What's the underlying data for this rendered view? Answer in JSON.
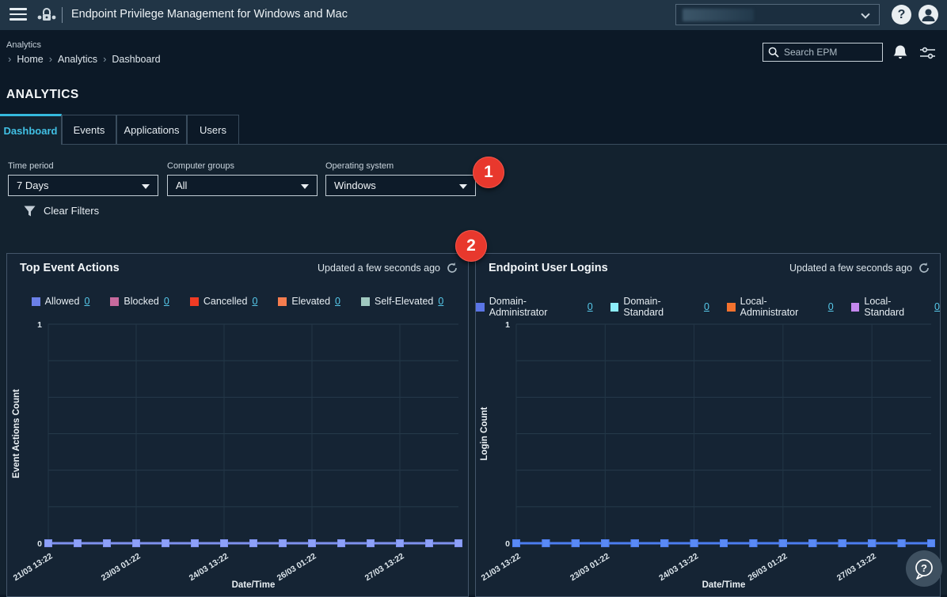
{
  "topbar": {
    "title": "Endpoint Privilege Management for Windows and Mac"
  },
  "header": {
    "section_label": "Analytics",
    "breadcrumb": [
      "Home",
      "Analytics",
      "Dashboard"
    ],
    "search_placeholder": "Search EPM"
  },
  "page_title": "ANALYTICS",
  "tabs": [
    {
      "label": "Dashboard",
      "active": true
    },
    {
      "label": "Events",
      "active": false
    },
    {
      "label": "Applications",
      "active": false
    },
    {
      "label": "Users",
      "active": false
    }
  ],
  "filters": {
    "fields": [
      {
        "label": "Time period",
        "value": "7 Days"
      },
      {
        "label": "Computer groups",
        "value": "All"
      },
      {
        "label": "Operating system",
        "value": "Windows"
      }
    ],
    "clear_label": "Clear Filters"
  },
  "callouts": [
    {
      "label": "1"
    },
    {
      "label": "2"
    }
  ],
  "colors": {
    "accent_cyan": "#41c0e4",
    "badge_red": "#e8382d",
    "link_cyan": "#56c9ea",
    "card_border": "#44566a"
  },
  "cards": [
    {
      "title": "Top Event Actions",
      "updated": "Updated a few seconds ago",
      "legend": [
        {
          "label": "Allowed",
          "value": "0",
          "color": "#6b80e8"
        },
        {
          "label": "Blocked",
          "value": "0",
          "color": "#c76a9d"
        },
        {
          "label": "Cancelled",
          "value": "0",
          "color": "#ef3b24"
        },
        {
          "label": "Elevated",
          "value": "0",
          "color": "#f57d4f"
        },
        {
          "label": "Self-Elevated",
          "value": "0",
          "color": "#a0c9c0"
        }
      ]
    },
    {
      "title": "Endpoint User Logins",
      "updated": "Updated a few seconds ago",
      "legend": [
        {
          "label": "Domain-Administrator",
          "value": "0",
          "color": "#5a75e6"
        },
        {
          "label": "Domain-Standard",
          "value": "0",
          "color": "#8deefc"
        },
        {
          "label": "Local-Administrator",
          "value": "0",
          "color": "#f4722e"
        },
        {
          "label": "Local-Standard",
          "value": "0",
          "color": "#c488ee"
        }
      ]
    }
  ],
  "chart_data": [
    {
      "type": "line",
      "title": "Top Event Actions",
      "xlabel": "Date/Time",
      "ylabel": "Event Actions Count",
      "ylim": [
        0,
        1
      ],
      "y_ticks": [
        0,
        1
      ],
      "grid": true,
      "legend_position": "top",
      "num_points": 15,
      "x_tick_labels": [
        "21/03 13:22",
        "23/03 01:22",
        "24/03 13:22",
        "26/03 01:22",
        "27/03 13:22"
      ],
      "x_tick_indices": [
        0,
        3,
        6,
        9,
        12
      ],
      "series": [
        {
          "name": "Allowed",
          "color": "#7e91ee",
          "marker": "#8da0f8",
          "values": [
            0,
            0,
            0,
            0,
            0,
            0,
            0,
            0,
            0,
            0,
            0,
            0,
            0,
            0,
            0
          ]
        },
        {
          "name": "Blocked",
          "color": "#c76a9d",
          "marker": "#c76a9d",
          "values": [
            0,
            0,
            0,
            0,
            0,
            0,
            0,
            0,
            0,
            0,
            0,
            0,
            0,
            0,
            0
          ]
        },
        {
          "name": "Cancelled",
          "color": "#ef3b24",
          "marker": "#ef3b24",
          "values": [
            0,
            0,
            0,
            0,
            0,
            0,
            0,
            0,
            0,
            0,
            0,
            0,
            0,
            0,
            0
          ]
        },
        {
          "name": "Elevated",
          "color": "#f57d4f",
          "marker": "#f57d4f",
          "values": [
            0,
            0,
            0,
            0,
            0,
            0,
            0,
            0,
            0,
            0,
            0,
            0,
            0,
            0,
            0
          ]
        },
        {
          "name": "Self-Elevated",
          "color": "#a0c9c0",
          "marker": "#a0c9c0",
          "values": [
            0,
            0,
            0,
            0,
            0,
            0,
            0,
            0,
            0,
            0,
            0,
            0,
            0,
            0,
            0
          ]
        }
      ]
    },
    {
      "type": "line",
      "title": "Endpoint User Logins",
      "xlabel": "Date/Time",
      "ylabel": "Login Count",
      "ylim": [
        0,
        1
      ],
      "y_ticks": [
        0,
        1
      ],
      "grid": true,
      "legend_position": "top",
      "num_points": 15,
      "x_tick_labels": [
        "21/03 13:22",
        "23/03 01:22",
        "24/03 13:22",
        "26/03 01:22",
        "27/03 13:22"
      ],
      "x_tick_indices": [
        0,
        3,
        6,
        9,
        12
      ],
      "series": [
        {
          "name": "Domain-Administrator",
          "color": "#4c7df0",
          "marker": "#5a8af5",
          "values": [
            0,
            0,
            0,
            0,
            0,
            0,
            0,
            0,
            0,
            0,
            0,
            0,
            0,
            0,
            0
          ]
        },
        {
          "name": "Domain-Standard",
          "color": "#8deefc",
          "marker": "#8deefc",
          "values": [
            0,
            0,
            0,
            0,
            0,
            0,
            0,
            0,
            0,
            0,
            0,
            0,
            0,
            0,
            0
          ]
        },
        {
          "name": "Local-Administrator",
          "color": "#f4722e",
          "marker": "#f4722e",
          "values": [
            0,
            0,
            0,
            0,
            0,
            0,
            0,
            0,
            0,
            0,
            0,
            0,
            0,
            0,
            0
          ]
        },
        {
          "name": "Local-Standard",
          "color": "#c488ee",
          "marker": "#c488ee",
          "values": [
            0,
            0,
            0,
            0,
            0,
            0,
            0,
            0,
            0,
            0,
            0,
            0,
            0,
            0,
            0
          ]
        }
      ]
    }
  ]
}
